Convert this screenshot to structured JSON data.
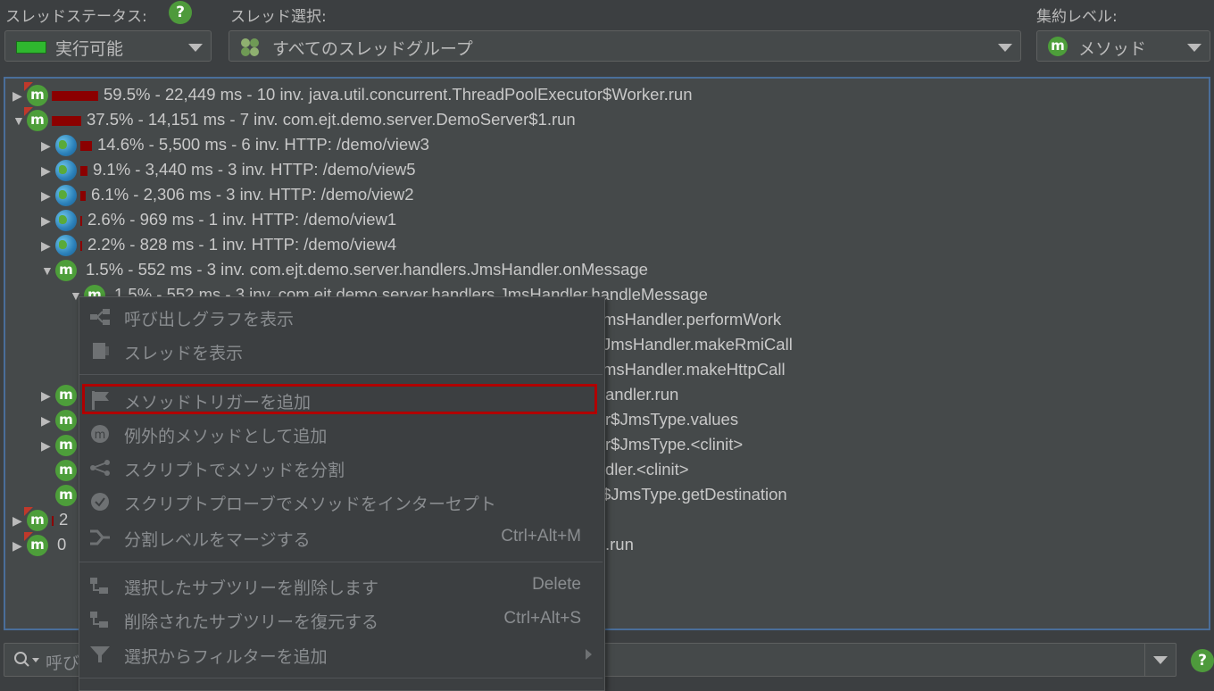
{
  "header": {
    "thread_status_label": "スレッドステータス:",
    "thread_status_value": "実行可能",
    "thread_select_label": "スレッド選択:",
    "thread_select_value": "すべてのスレッドグループ",
    "aggregation_label": "集約レベル:",
    "aggregation_value": "メソッド",
    "help_glyph": "?"
  },
  "tree": {
    "rows": [
      {
        "text": "59.5% - 22,449 ms - 10 inv. java.util.concurrent.ThreadPoolExecutor$Worker.run",
        "percent": 59.5
      },
      {
        "text": "37.5% - 14,151 ms - 7 inv. com.ejt.demo.server.DemoServer$1.run",
        "percent": 37.5
      },
      {
        "text": "14.6% - 5,500 ms - 6 inv. HTTP: /demo/view3",
        "percent": 14.6
      },
      {
        "text": "9.1% - 3,440 ms - 3 inv. HTTP: /demo/view5",
        "percent": 9.1
      },
      {
        "text": "6.1% - 2,306 ms - 3 inv. HTTP: /demo/view2",
        "percent": 6.1
      },
      {
        "text": "2.6% - 969 ms - 1 inv. HTTP: /demo/view1",
        "percent": 2.6
      },
      {
        "text": "2.2% - 828 ms - 1 inv. HTTP: /demo/view4",
        "percent": 2.2
      },
      {
        "text": "1.5% - 552 ms - 3 inv. com.ejt.demo.server.handlers.JmsHandler.onMessage",
        "percent": 1.5
      },
      {
        "text": "1.5% - 552 ms - 3 inv. com.ejt.demo.server.handlers.JmsHandler.handleMessage",
        "percent": 1.5
      },
      {
        "text": "msHandler.performWork"
      },
      {
        "text": "JmsHandler.makeRmiCall"
      },
      {
        "text": "msHandler.makeHttpCall"
      },
      {
        "text": "andler.run"
      },
      {
        "text": "r$JmsType.values"
      },
      {
        "text": "r$JmsType.<clinit>"
      },
      {
        "text": "dler.<clinit>"
      },
      {
        "text": "$JmsType.getDestination"
      },
      {
        "text": "2"
      },
      {
        "text": "0"
      },
      {
        "text": ".run"
      }
    ]
  },
  "context_menu": {
    "items": [
      {
        "label": "呼び出しグラフを表示",
        "shortcut": "",
        "icon": "call-graph-icon"
      },
      {
        "label": "スレッドを表示",
        "shortcut": "",
        "icon": "thread-icon"
      },
      {
        "label": "メソッドトリガーを追加",
        "shortcut": "",
        "icon": "flag-icon"
      },
      {
        "label": "例外的メソッドとして追加",
        "shortcut": "",
        "icon": "exceptional-method-icon"
      },
      {
        "label": "スクリプトでメソッドを分割",
        "shortcut": "",
        "icon": "split-icon"
      },
      {
        "label": "スクリプトプローブでメソッドをインターセプト",
        "shortcut": "",
        "icon": "probe-icon"
      },
      {
        "label": "分割レベルをマージする",
        "shortcut": "Ctrl+Alt+M",
        "icon": "merge-icon"
      },
      {
        "label": "選択したサブツリーを削除します",
        "shortcut": "Delete",
        "icon": "delete-subtree-icon"
      },
      {
        "label": "削除されたサブツリーを復元する",
        "shortcut": "Ctrl+Alt+S",
        "icon": "restore-subtree-icon"
      },
      {
        "label": "選択からフィルターを追加",
        "shortcut": "",
        "icon": "filter-icon"
      }
    ]
  },
  "search": {
    "placeholder": "呼び"
  },
  "colors": {
    "background": "#3c3f41",
    "tree_background": "#45494a",
    "selection_border": "#4a6e9a",
    "highlight": "#b00000",
    "bar": "#8b0000",
    "badge_green": "#4d9e3a"
  }
}
